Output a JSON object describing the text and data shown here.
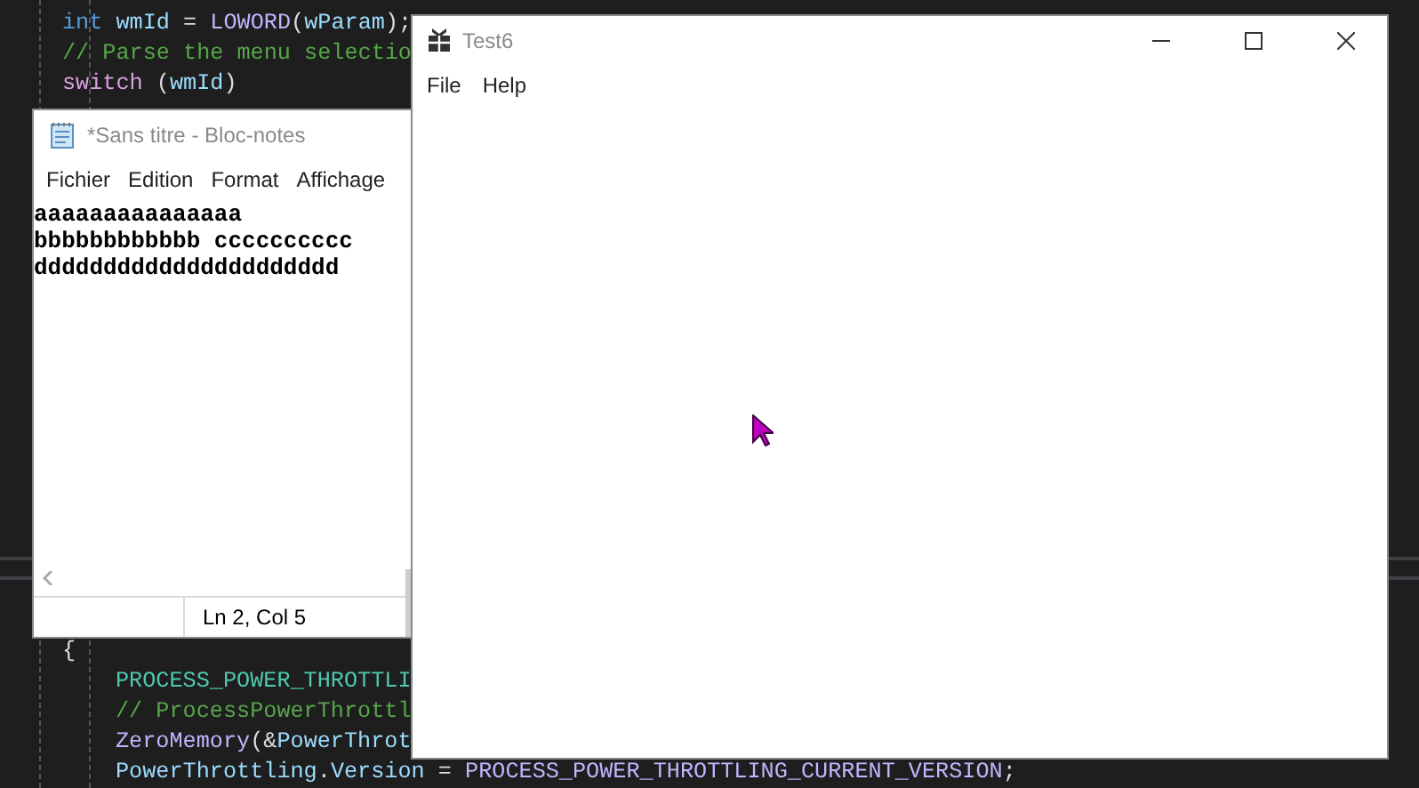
{
  "editor": {
    "code_top": [
      {
        "segments": [
          {
            "text": "int",
            "kind": "keyword"
          },
          {
            "text": " wmId",
            "kind": "variable"
          },
          {
            "text": " = ",
            "kind": "plain"
          },
          {
            "text": "LOWORD",
            "kind": "macro"
          },
          {
            "text": "(",
            "kind": "plain"
          },
          {
            "text": "wParam",
            "kind": "param"
          },
          {
            "text": ");",
            "kind": "plain"
          }
        ]
      },
      {
        "segments": [
          {
            "text": "// Parse the menu selectio",
            "kind": "comment"
          }
        ]
      },
      {
        "segments": [
          {
            "text": "switch",
            "kind": "control"
          },
          {
            "text": " (",
            "kind": "plain"
          },
          {
            "text": "wmId",
            "kind": "variable"
          },
          {
            "text": ")",
            "kind": "plain"
          }
        ]
      }
    ],
    "code_bottom": [
      {
        "segments": [
          {
            "text": "{",
            "kind": "plain"
          }
        ],
        "children": [
          {
            "segments": [
              {
                "text": "PROCESS_POWER_THROTTLI",
                "kind": "type"
              }
            ]
          },
          {
            "segments": [
              {
                "text": "// ProcessPowerThrottl",
                "kind": "comment"
              }
            ]
          },
          {
            "segments": [
              {
                "text": "ZeroMemory",
                "kind": "macro"
              },
              {
                "text": "(&",
                "kind": "plain"
              },
              {
                "text": "PowerThrot",
                "kind": "variable"
              }
            ]
          },
          {
            "segments": [
              {
                "text": "PowerThrottling",
                "kind": "variable"
              },
              {
                "text": ".",
                "kind": "plain"
              },
              {
                "text": "Version",
                "kind": "variable"
              },
              {
                "text": " = ",
                "kind": "plain"
              },
              {
                "text": "PROCESS_POWER_THROTTLING_CURRENT_VERSION",
                "kind": "macro"
              },
              {
                "text": ";",
                "kind": "plain"
              }
            ]
          }
        ]
      }
    ]
  },
  "notepad": {
    "title": "*Sans titre - Bloc-notes",
    "menu": [
      "Fichier",
      "Edition",
      "Format",
      "Affichage"
    ],
    "lines": [
      "aaaaaaaaaaaaaaa",
      "bbbbbbbbbbbb cccccccccc",
      "dddddddddddddddddddddd"
    ],
    "status": "Ln 2, Col 5"
  },
  "test_window": {
    "title": "Test6",
    "menu": [
      "File",
      "Help"
    ]
  }
}
